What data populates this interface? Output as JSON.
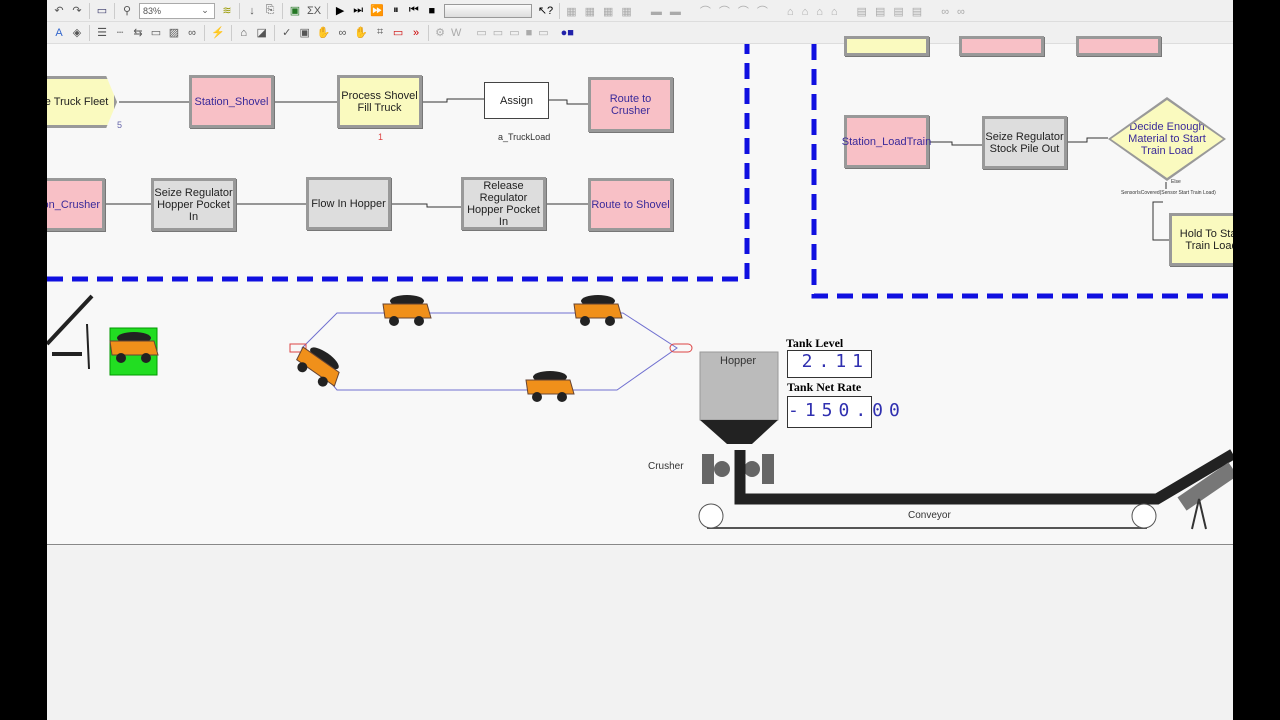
{
  "toolbar": {
    "zoom_value": "83%"
  },
  "modules": {
    "create_truck_fleet": "ate Truck Fleet",
    "create_counter": "5",
    "station_shovel": "Station_Shovel",
    "process_shovel": "Process Shovel Fill Truck",
    "process_counter": "1",
    "assign": "Assign",
    "assign_label": "a_TruckLoad",
    "route_crusher": "Route to Crusher",
    "station_crusher": "on_Crusher",
    "seize_hopper": "Seize Regulator Hopper Pocket In",
    "flow_hopper": "Flow In Hopper",
    "release_hopper": "Release Regulator Hopper Pocket In",
    "route_shovel": "Route to Shovel",
    "station_loadtrain": "Station_LoadTrain",
    "seize_stockpile": "Seize Regulator Stock Pile Out",
    "decide": "Decide Enough Material to Start Train Load",
    "decide_else": "Else",
    "decide_condition": "SensorIsCovered(Sensor Start Train Load)",
    "hold": "Hold To Start Train Load"
  },
  "animation": {
    "hopper": "Hopper",
    "crusher": "Crusher",
    "conveyor": "Conveyor",
    "tank_level_title": "Tank Level",
    "tank_level_value": "2.11",
    "tank_rate_title": "Tank Net Rate",
    "tank_rate_value": "-150.00"
  },
  "colors": {
    "station": "#f8c0c6",
    "process": "#fafabf",
    "seize": "#dddddd",
    "boundary": "#1010e0",
    "truck": "#f0901a"
  }
}
